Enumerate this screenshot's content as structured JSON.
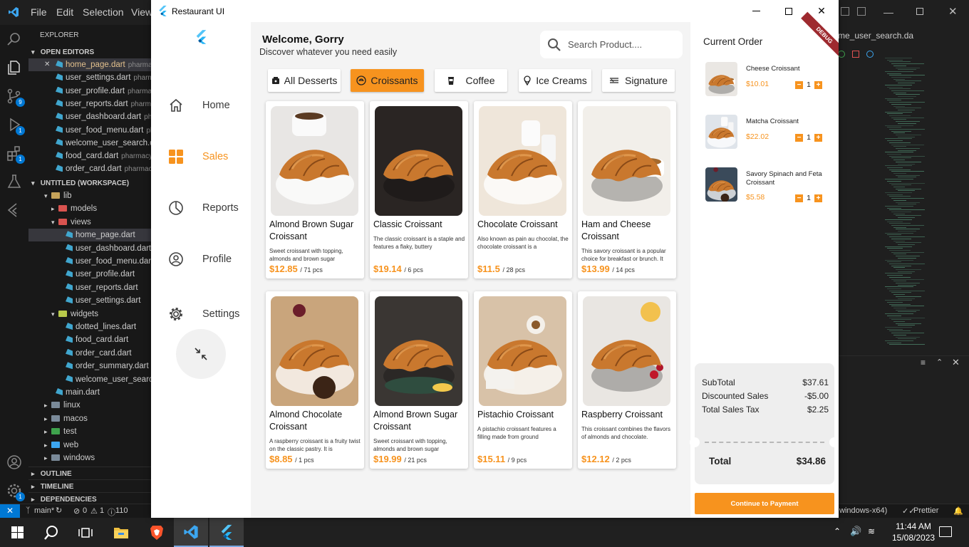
{
  "vscode": {
    "menu": [
      "File",
      "Edit",
      "Selection",
      "View"
    ],
    "explorer_title": "EXPLORER",
    "open_editors_title": "OPEN EDITORS",
    "open_editors": [
      {
        "name": "home_page.dart",
        "hint": "pharmac"
      },
      {
        "name": "user_settings.dart",
        "hint": "pharma"
      },
      {
        "name": "user_profile.dart",
        "hint": "pharmac"
      },
      {
        "name": "user_reports.dart",
        "hint": "pharma"
      },
      {
        "name": "user_dashboard.dart",
        "hint": "pha"
      },
      {
        "name": "user_food_menu.dart",
        "hint": "ph"
      },
      {
        "name": "welcome_user_search.dart",
        "hint": ""
      },
      {
        "name": "food_card.dart",
        "hint": "pharmacy_"
      },
      {
        "name": "order_card.dart",
        "hint": "pharmacy"
      }
    ],
    "workspace_title": "UNTITLED (WORKSPACE)",
    "tree": {
      "lib": "lib",
      "models": "models",
      "views": "views",
      "views_files": [
        "home_page.dart",
        "user_dashboard.dart",
        "user_food_menu.dart",
        "user_profile.dart",
        "user_reports.dart",
        "user_settings.dart"
      ],
      "widgets": "widgets",
      "widgets_files": [
        "dotted_lines.dart",
        "food_card.dart",
        "order_card.dart",
        "order_summary.dart",
        "welcome_user_search."
      ],
      "main": "main.dart",
      "folders": [
        "linux",
        "macos",
        "test",
        "web",
        "windows"
      ]
    },
    "outline": "OUTLINE",
    "timeline": "TIMELINE",
    "dependencies": "DEPENDENCIES",
    "right_tab": "me_user_search.da",
    "status": {
      "branch": "main*",
      "problems": "0",
      "warnings": "1",
      "info": "110",
      "platform": "windows-x64)",
      "prettier": "Prettier"
    },
    "badges": {
      "scm": "9",
      "debug": "1",
      "extensions": "1",
      "settings": "1"
    }
  },
  "taskbar": {
    "time": "11:44 AM",
    "date": "15/08/2023"
  },
  "app": {
    "window_title": "Restaurant UI",
    "nav": [
      {
        "label": "Home",
        "icon": "home-icon"
      },
      {
        "label": "Sales",
        "icon": "grid-icon"
      },
      {
        "label": "Reports",
        "icon": "pie-chart-icon"
      },
      {
        "label": "Profile",
        "icon": "user-circle-icon"
      },
      {
        "label": "Settings",
        "icon": "gear-icon"
      }
    ],
    "active_nav": "Sales",
    "welcome_title": "Welcome, Gorry",
    "welcome_sub": "Discover whatever you need easily",
    "search_placeholder": "Search Product....",
    "categories": [
      {
        "label": "All Desserts",
        "icon": "cake-icon"
      },
      {
        "label": "Croissants",
        "icon": "croissant-icon"
      },
      {
        "label": "Coffee",
        "icon": "coffee-cup-icon"
      },
      {
        "label": "Ice Creams",
        "icon": "ice-cream-icon"
      },
      {
        "label": "Signature",
        "icon": "signature-icon"
      }
    ],
    "active_category": "Croissants",
    "products": [
      {
        "name": "Almond Brown Sugar Croissant",
        "desc": "Sweet croissant with topping, almonds and brown sugar",
        "price": "$12.85",
        "stock": "/ 71 pcs"
      },
      {
        "name": "Classic Croissant",
        "desc": "The classic croissant is a staple and features a flaky, buttery",
        "price": "$19.14",
        "stock": "/ 6 pcs"
      },
      {
        "name": "Chocolate Croissant",
        "desc": "Also known as pain au chocolat, the chocolate croissant is a",
        "price": "$11.5",
        "stock": "/ 28 pcs"
      },
      {
        "name": "Ham and Cheese Croissant",
        "desc": " This savory croissant is a popular choice for breakfast or brunch. It",
        "price": "$13.99",
        "stock": "/ 14 pcs"
      },
      {
        "name": "Almond Chocolate Croissant",
        "desc": " A raspberry croissant is a fruity twist on the classic pastry. It is",
        "price": "$8.85",
        "stock": "/ 1 pcs"
      },
      {
        "name": "Almond Brown Sugar Croissant",
        "desc": "Sweet croissant with topping, almonds and brown sugar",
        "price": "$19.99",
        "stock": "/ 21 pcs"
      },
      {
        "name": "Pistachio Croissant",
        "desc": "A pistachio croissant features a filling made from ground",
        "price": "$15.11",
        "stock": "/ 9 pcs"
      },
      {
        "name": "Raspberry Croissant",
        "desc": "This croissant combines the flavors of almonds and chocolate.",
        "price": "$12.12",
        "stock": "/ 2 pcs"
      }
    ],
    "order": {
      "title": "Current Order",
      "debug_label": "DEBUG",
      "items": [
        {
          "name": "Cheese Croissant",
          "price": "$10.01",
          "qty": "1"
        },
        {
          "name": "Matcha Croissant",
          "price": "$22.02",
          "qty": "1"
        },
        {
          "name": "Savory Spinach and Feta Croissant",
          "price": "$5.58",
          "qty": "1"
        }
      ],
      "summary": {
        "subtotal_label": "SubTotal",
        "subtotal": "$37.61",
        "discount_label": "Discounted Sales",
        "discount": "-$5.00",
        "tax_label": "Total Sales Tax",
        "tax": "$2.25",
        "total_label": "Total",
        "total": "$34.86"
      },
      "pay_label": "Continue to Payment"
    }
  },
  "colors": {
    "accent": "#f7931e",
    "panel_bg": "#f4f4f4",
    "vscode_bg": "#1e1e1e"
  }
}
